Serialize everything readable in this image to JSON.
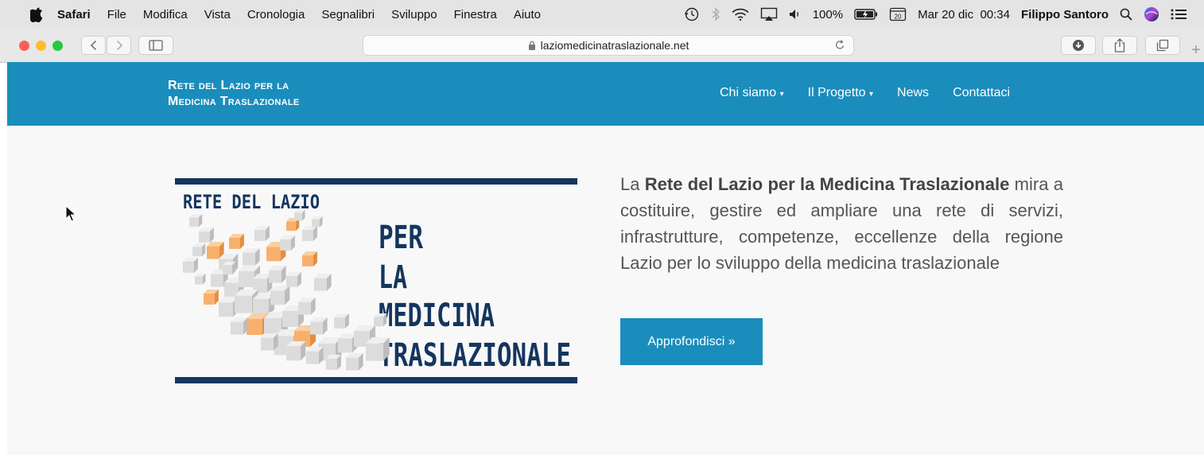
{
  "menubar": {
    "app_name": "Safari",
    "items": [
      "File",
      "Modifica",
      "Vista",
      "Cronologia",
      "Segnalibri",
      "Sviluppo",
      "Finestra",
      "Aiuto"
    ],
    "battery": "100%",
    "datetime": "Mar 20 dic  00:34",
    "user": "Filippo Santoro",
    "calendar_day": "20"
  },
  "browser": {
    "url": "laziomedicinatraslazionale.net",
    "icons": {
      "back": "chevron-left-icon",
      "forward": "chevron-right-icon",
      "sidebar": "sidebar-icon",
      "reload": "reload-icon",
      "downloads": "download-icon",
      "share": "share-icon",
      "tabs": "tabs-icon",
      "new_tab": "plus-icon"
    },
    "traffic_lights": {
      "close": "#fe5f57",
      "minimize": "#febc2e",
      "zoom": "#28c840"
    }
  },
  "site": {
    "brand_line1": "Rete del Lazio per la",
    "brand_line2": "Medicina Traslazionale",
    "nav": [
      {
        "label": "Chi siamo",
        "dropdown": true
      },
      {
        "label": "Il Progetto",
        "dropdown": true
      },
      {
        "label": "News",
        "dropdown": false
      },
      {
        "label": "Contattaci",
        "dropdown": false
      }
    ],
    "logo_text": {
      "top": "RETE DEL LAZIO",
      "line1": "PER",
      "line2": "LA",
      "line3": "MEDICINA",
      "line4": "TRASLAZIONALE"
    },
    "hero": {
      "prefix": "La ",
      "strong": "Rete del Lazio per la Medicina Traslazionale",
      "rest": " mira a costituire, gestire ed ampliare una rete di servizi, infrastrutture, competenze, eccellenze della regione Lazio per lo sviluppo della medicina traslazionale",
      "button": "Approfondisci »"
    },
    "colors": {
      "primary": "#1a8dbd",
      "logo_navy": "#14355e",
      "accent_orange": "#f5a55a"
    }
  }
}
